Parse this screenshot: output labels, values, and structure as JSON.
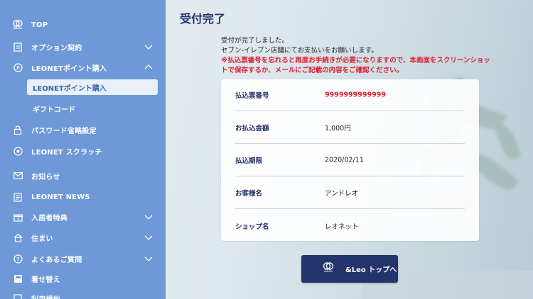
{
  "sidebar": {
    "logo_small": "&Leo",
    "items": [
      {
        "label": "TOP"
      },
      {
        "label": "オプション契約"
      },
      {
        "label": "LEONETポイント購入"
      },
      {
        "label": "パスワード省略設定"
      },
      {
        "label": "LEONET スクラッチ"
      },
      {
        "label": "お知らせ"
      },
      {
        "label": "LEONET NEWS"
      },
      {
        "label": "入居者特典"
      },
      {
        "label": "住まい"
      },
      {
        "label": "よくあるご質問"
      },
      {
        "label": "着せ替え"
      },
      {
        "label": "利用規約"
      }
    ],
    "sub_items": [
      {
        "label": "LEONETポイント購入"
      },
      {
        "label": "ギフトコード"
      }
    ]
  },
  "main": {
    "title": "受付完了",
    "message_line1": "受付が完了しました。",
    "message_line2": "セブン-イレブン店舗にてお支払いをお願いします。",
    "warning": "※払込票番号を忘れると再度お手続きが必要になりますので、本画面をスクリーンショットで保存するか、メールにご記載の内容をご確認ください。",
    "rows": [
      {
        "label": "払込票番号",
        "value": "9999999999999"
      },
      {
        "label": "お払込金額",
        "value": "1,000円"
      },
      {
        "label": "払込期限",
        "value": "2020/02/11"
      },
      {
        "label": "お客様名",
        "value": "アンドレオ"
      },
      {
        "label": "ショップ名",
        "value": "レオネット"
      }
    ],
    "top_button": {
      "label": "&Leo トップへ",
      "logo_text": "&Leo"
    }
  },
  "colors": {
    "sidebar": "#6e98d8",
    "accent_navy": "#23336b",
    "warning_red": "#e01e2d"
  },
  "icons": {
    "top": "leo-logo-icon",
    "option": "contract-icon",
    "points": "points-icon",
    "password": "lock-icon",
    "scratch": "scratch-icon",
    "news_notice": "mail-icon",
    "leonet_news": "news-icon",
    "benefits": "gift-icon",
    "home": "house-icon",
    "faq": "question-icon",
    "theme": "theme-icon"
  }
}
